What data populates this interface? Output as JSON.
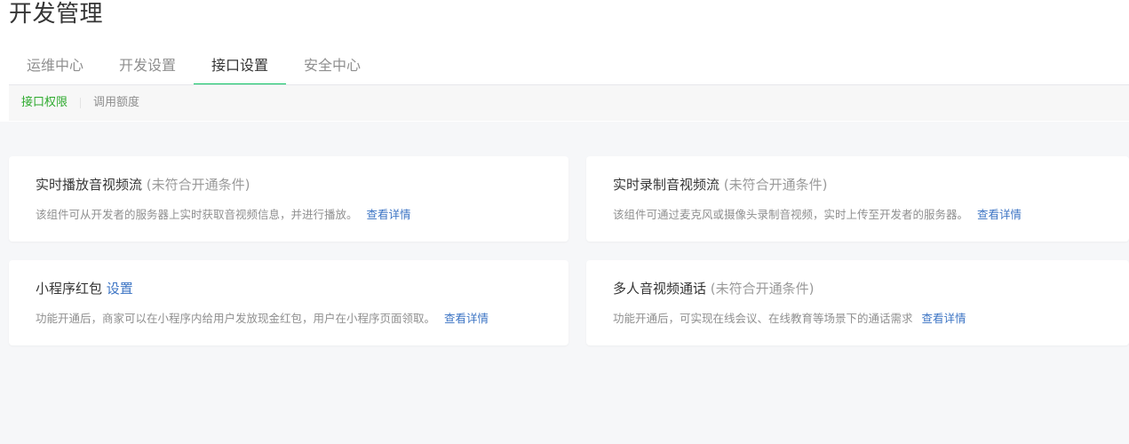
{
  "page": {
    "title": "开发管理"
  },
  "tabs": [
    {
      "label": "运维中心"
    },
    {
      "label": "开发设置"
    },
    {
      "label": "接口设置"
    },
    {
      "label": "安全中心"
    }
  ],
  "subtabs": [
    {
      "label": "接口权限"
    },
    {
      "label": "调用额度"
    }
  ],
  "cards": [
    {
      "title": "实时播放音视频流",
      "status": "(未符合开通条件)",
      "desc": "该组件可从开发者的服务器上实时获取音视频信息，并进行播放。",
      "link": "查看详情"
    },
    {
      "title": "实时录制音视频流",
      "status": "(未符合开通条件)",
      "desc": "该组件可通过麦克风或摄像头录制音视频，实时上传至开发者的服务器。",
      "link": "查看详情"
    },
    {
      "title": "小程序红包",
      "action": "设置",
      "desc": "功能开通后，商家可以在小程序内给用户发放现金红包，用户在小程序页面领取。",
      "link": "查看详情"
    },
    {
      "title": "多人音视频通话",
      "status": "(未符合开通条件)",
      "desc": "功能开通后，可实现在线会议、在线教育等场景下的通话需求",
      "link": "查看详情"
    }
  ],
  "colors": {
    "accent_green": "#07c160",
    "active_subtab": "#2eaa2e",
    "link_blue": "#3c74c4",
    "muted_text": "#8f8f8f"
  }
}
